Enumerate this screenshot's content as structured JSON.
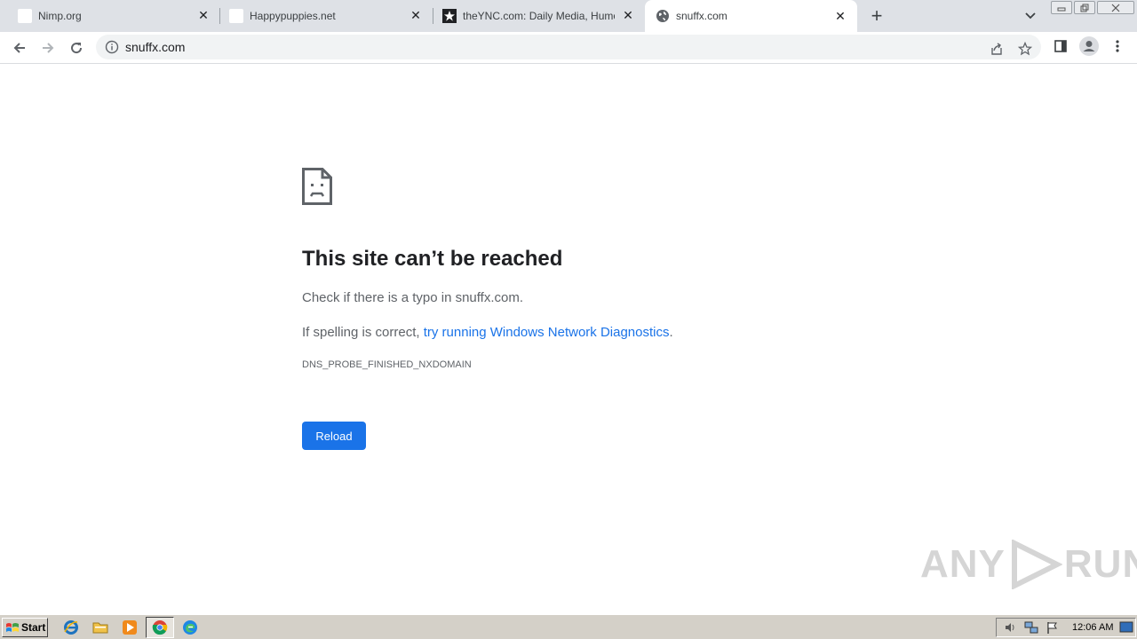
{
  "browser": {
    "tabs": [
      {
        "title": "Nimp.org",
        "favicon": "blank-page-icon"
      },
      {
        "title": "Happypuppies.net",
        "favicon": "blank-page-icon"
      },
      {
        "title": "theYNC.com: Daily Media, Humor, Sh",
        "favicon": "ync-star-icon"
      },
      {
        "title": "snuffx.com",
        "favicon": "globe-icon",
        "active": true
      }
    ],
    "new_tab_symbol": "+",
    "close_symbol": "✕",
    "address": "snuffx.com"
  },
  "error_page": {
    "title": "This site can’t be reached",
    "line1": "Check if there is a typo in snuffx.com.",
    "line2_prefix": "If spelling is correct, ",
    "line2_link": "try running Windows Network Diagnostics",
    "line2_suffix": ".",
    "error_code": "DNS_PROBE_FINISHED_NXDOMAIN",
    "reload_label": "Reload",
    "reload_color": "#1a73e8",
    "link_color": "#1a73e8"
  },
  "watermark": {
    "text_left": "ANY",
    "text_right": "RUN"
  },
  "taskbar": {
    "start_label": "Start",
    "clock": "12:06 AM",
    "pinned": [
      "internet-explorer-icon",
      "folder-icon",
      "media-player-icon",
      "chrome-icon",
      "edge-icon"
    ]
  }
}
